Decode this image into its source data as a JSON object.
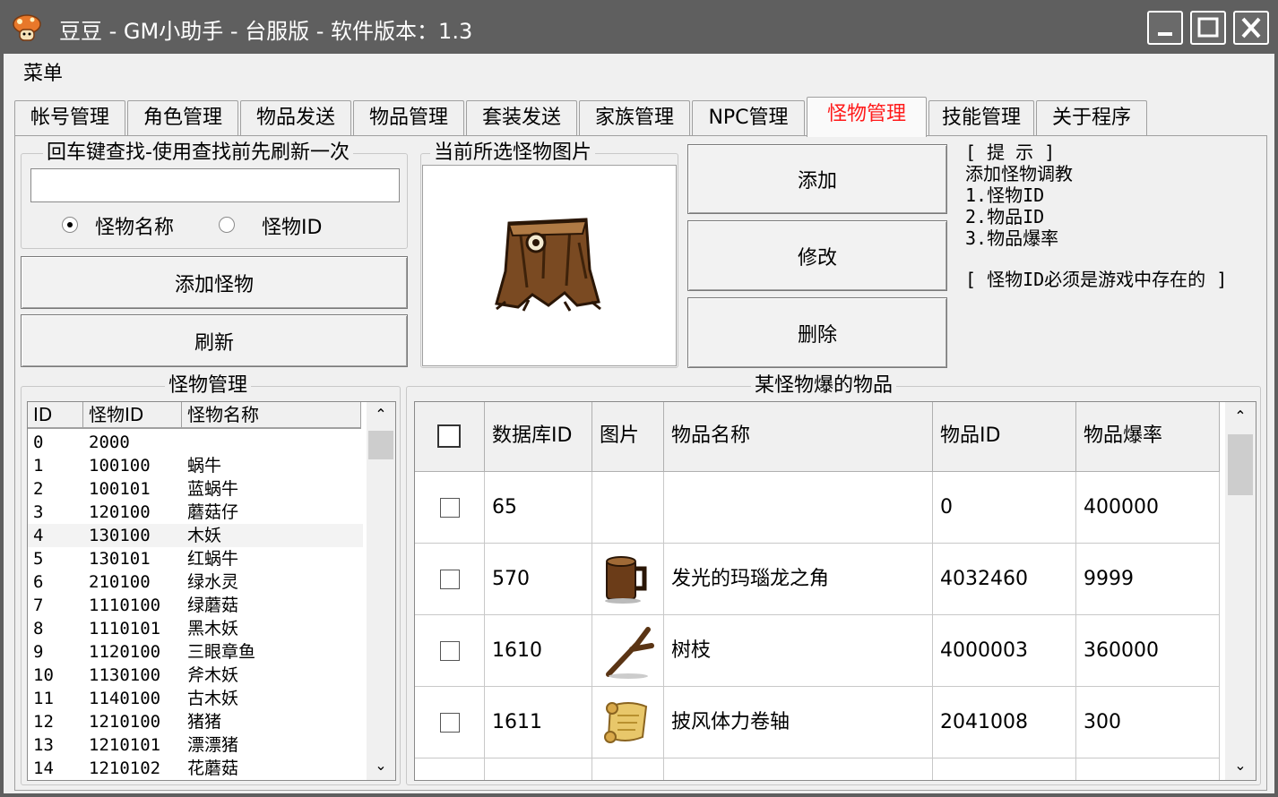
{
  "window": {
    "title": "豆豆 - GM小助手 - 台服版 - 软件版本：1.3",
    "controls": [
      "minimize-icon",
      "maximize-icon",
      "close-icon"
    ]
  },
  "menu": {
    "items": [
      "菜单"
    ]
  },
  "tabs": [
    {
      "label": "帐号管理"
    },
    {
      "label": "角色管理"
    },
    {
      "label": "物品发送"
    },
    {
      "label": "物品管理"
    },
    {
      "label": "套装发送"
    },
    {
      "label": "家族管理"
    },
    {
      "label": "NPC管理"
    },
    {
      "label": "怪物管理"
    },
    {
      "label": "技能管理"
    },
    {
      "label": "关于程序"
    }
  ],
  "active_tab": "怪物管理",
  "search": {
    "group_label": "回车键查找-使用查找前先刷新一次",
    "value": "",
    "radio_name": "怪物名称",
    "radio_id": "怪物ID",
    "selected_radio": "怪物名称"
  },
  "buttons": {
    "add_monster": "添加怪物",
    "refresh": "刷新",
    "add": "添加",
    "modify": "修改",
    "delete": "删除"
  },
  "preview": {
    "group_label": "当前所选怪物图片",
    "image": "tree-stump-monster-image"
  },
  "hint": {
    "title": "[ 提 示 ]",
    "line1": "添加怪物调教",
    "line2": "1.怪物ID",
    "line3": "2.物品ID",
    "line4": "3.物品爆率",
    "note": "[ 怪物ID必须是游戏中存在的 ]"
  },
  "monster_list": {
    "group_label": "怪物管理",
    "columns": [
      "ID",
      "怪物ID",
      "怪物名称"
    ],
    "rows": [
      [
        "0",
        "2000",
        ""
      ],
      [
        "1",
        "100100",
        "蜗牛"
      ],
      [
        "2",
        "100101",
        "蓝蜗牛"
      ],
      [
        "3",
        "120100",
        "蘑菇仔"
      ],
      [
        "4",
        "130100",
        "木妖"
      ],
      [
        "5",
        "130101",
        "红蜗牛"
      ],
      [
        "6",
        "210100",
        "绿水灵"
      ],
      [
        "7",
        "1110100",
        "绿蘑菇"
      ],
      [
        "8",
        "1110101",
        "黑木妖"
      ],
      [
        "9",
        "1120100",
        "三眼章鱼"
      ],
      [
        "10",
        "1130100",
        "斧木妖"
      ],
      [
        "11",
        "1140100",
        "古木妖"
      ],
      [
        "12",
        "1210100",
        "猪猪"
      ],
      [
        "13",
        "1210101",
        "漂漂猪"
      ],
      [
        "14",
        "1210102",
        "花蘑菇"
      ]
    ],
    "selected_row": 4
  },
  "drop_list": {
    "group_label": "某怪物爆的物品",
    "columns": [
      "数据库ID",
      "图片",
      "物品名称",
      "物品ID",
      "物品爆率"
    ],
    "rows": [
      {
        "db_id": "65",
        "icon": "",
        "name": "",
        "item_id": "0",
        "rate": "400000"
      },
      {
        "db_id": "570",
        "icon": "mug-icon",
        "name": "发光的玛瑙龙之角",
        "item_id": "4032460",
        "rate": "9999"
      },
      {
        "db_id": "1610",
        "icon": "branch-icon",
        "name": "树枝",
        "item_id": "4000003",
        "rate": "360000"
      },
      {
        "db_id": "1611",
        "icon": "scroll-icon",
        "name": "披风体力卷轴",
        "item_id": "2041008",
        "rate": "300"
      }
    ]
  },
  "colors": {
    "titlebar": "#5f5f5f",
    "active_tab_text": "#ff1a1a",
    "panel": "#f0f0f0"
  }
}
